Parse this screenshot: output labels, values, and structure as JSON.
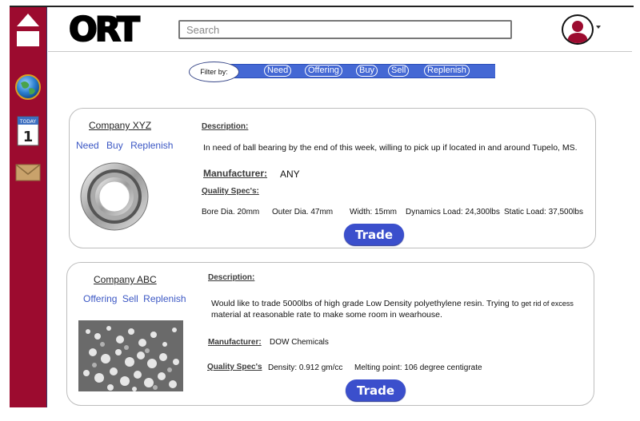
{
  "header": {
    "logo": "ORT",
    "search_placeholder": "Search"
  },
  "sidebar": {
    "calendar_label": "TODAY",
    "calendar_day": "1"
  },
  "filter": {
    "label": "Filter by:",
    "options": [
      "Need",
      "Offering",
      "Buy",
      "Sell",
      "Replenish"
    ]
  },
  "listings": [
    {
      "company": "Company XYZ",
      "actions": [
        "Need",
        "Buy",
        "Replenish"
      ],
      "description_label": "Description:",
      "description": "In need of ball bearing by the end of this week,  willing to pick up if located in and around Tupelo, MS.",
      "manufacturer_label": "Manufacturer:",
      "manufacturer": "ANY",
      "quality_label": "Quality Spec's:",
      "specs": [
        "Bore Dia. 20mm",
        "Outer Dia. 47mm",
        "Width: 15mm",
        "Dynamics Load: 24,300lbs",
        "Static Load: 37,500lbs"
      ],
      "trade_label": "Trade"
    },
    {
      "company": "Company ABC",
      "actions": [
        "Offering",
        "Sell",
        "Replenish"
      ],
      "description_label": "Description:",
      "description_line1": "Would like to trade 5000lbs of high grade Low Density polyethylene resin. Trying to",
      "description_line1_small": "get rid of excess",
      "description_line2": "material at reasonable rate to make some room in wearhouse.",
      "manufacturer_label": "Manufacturer:",
      "manufacturer": "DOW Chemicals",
      "quality_label": "Quality Spec's",
      "specs": [
        "Density: 0.912 gm/cc",
        "Melting point: 106 degree centigrate"
      ],
      "trade_label": "Trade"
    }
  ]
}
